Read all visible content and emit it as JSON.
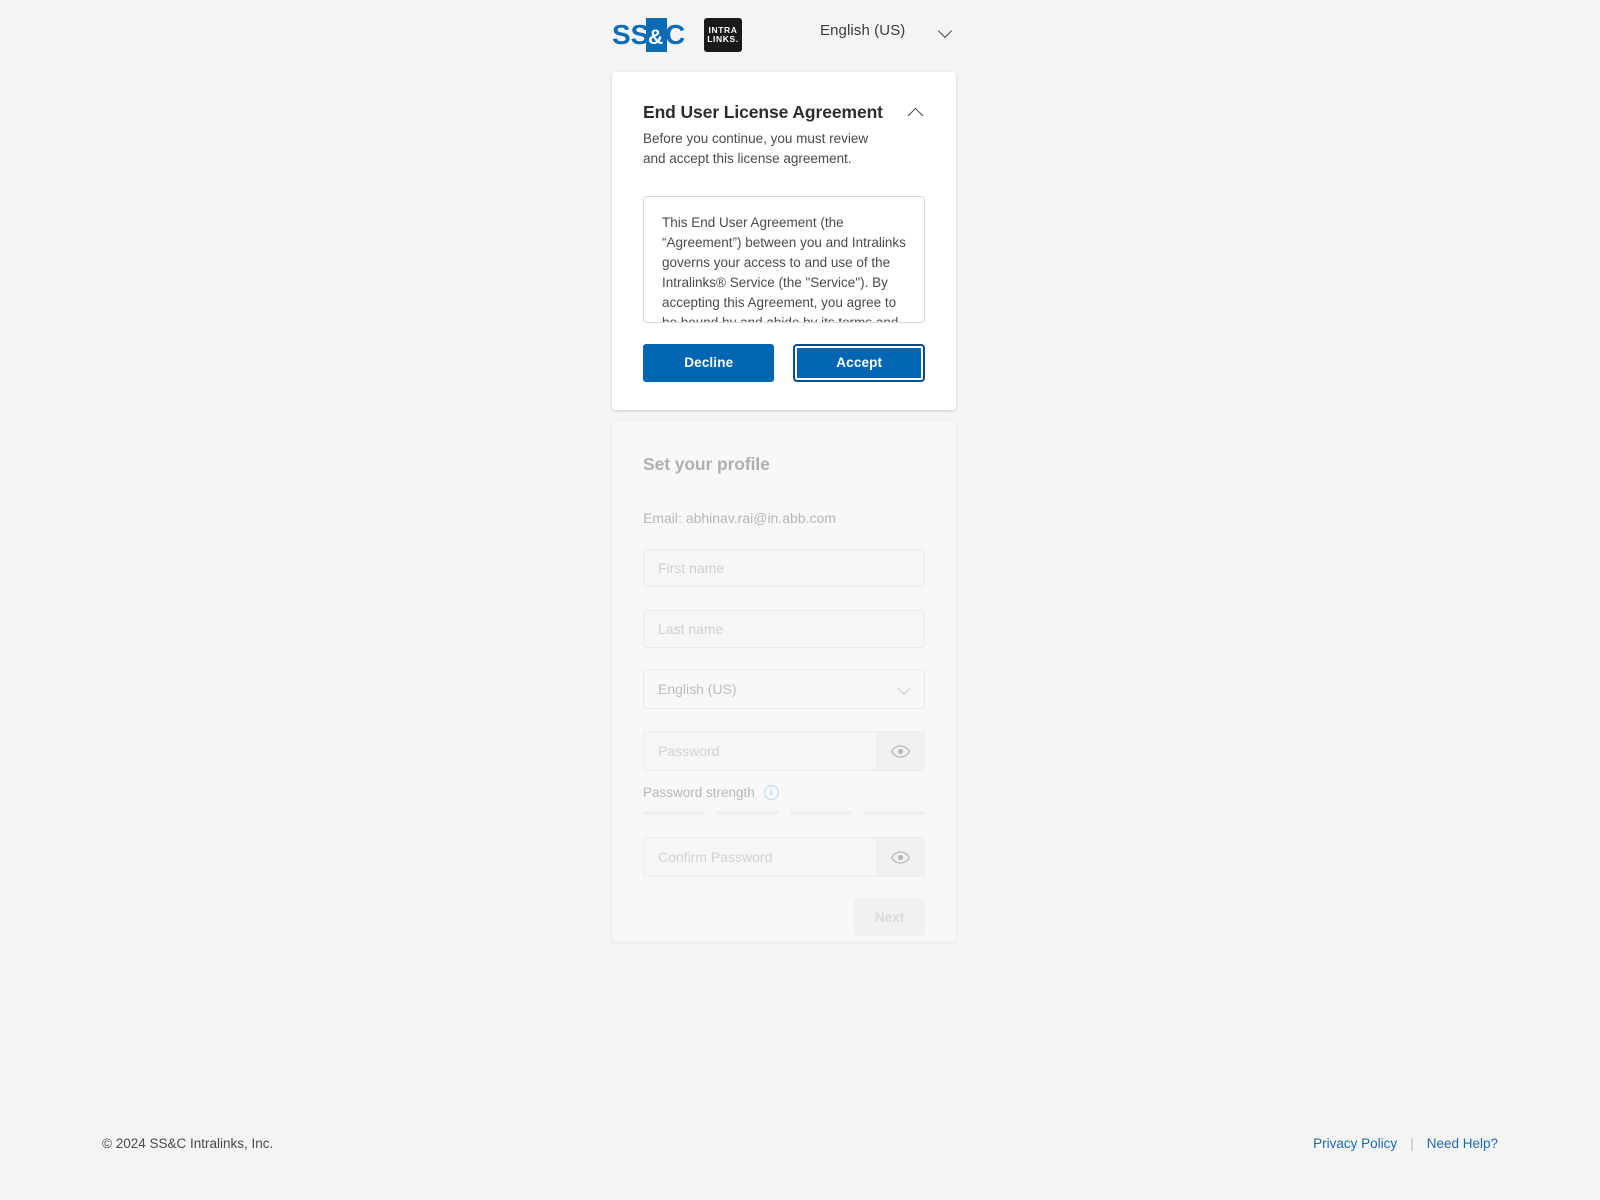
{
  "header": {
    "logo_ssc": "SS&C",
    "logo_ssc_parts": {
      "s1": "SS",
      "amp": "&",
      "c": "C"
    },
    "logo_intralinks_line1": "INTRA",
    "logo_intralinks_line2": "LINKS.",
    "language_selected": "English (US)",
    "language_chevron_icon": "chevron-down-icon"
  },
  "eula": {
    "title": "End User License Agreement",
    "collapse_icon": "chevron-up-icon",
    "subtitle": "Before you continue, you must review and accept this license agreement.",
    "body": "This End User Agreement (the “Agreement”) between you and Intralinks governs your access to and use of the Intralinks® Service (the \"Service\"). By accepting this Agreement, you agree to be bound by and abide by its terms and",
    "decline_label": "Decline",
    "accept_label": "Accept"
  },
  "profile": {
    "title": "Set your profile",
    "email_line": "Email: abhinav.rai@in.abb.com",
    "first_name_placeholder": "First name",
    "first_name_value": "",
    "last_name_placeholder": "Last name",
    "last_name_value": "",
    "language_selected": "English (US)",
    "language_chevron_icon": "chevron-down-icon",
    "password_placeholder": "Password",
    "password_value": "",
    "password_toggle_icon": "eye-icon",
    "password_strength_label": "Password strength",
    "password_strength_info_icon": "info-icon",
    "password_strength_bars": [
      0,
      0,
      0,
      0
    ],
    "confirm_password_placeholder": "Confirm Password",
    "confirm_password_value": "",
    "confirm_toggle_icon": "eye-icon",
    "next_label": "Next"
  },
  "footer": {
    "copyright": "© 2024 SS&C Intralinks, Inc.",
    "privacy_label": "Privacy Policy",
    "separator": "|",
    "help_label": "Need Help?"
  },
  "colors": {
    "page_background": "#f4f4f4",
    "card_background": "#ffffff",
    "brand_blue": "#0066b2",
    "focus_ring": "#0b4c8c",
    "link_blue": "#1c6bb0",
    "badge_black": "#1a1a1a",
    "info_blue": "#6aa8d8"
  }
}
